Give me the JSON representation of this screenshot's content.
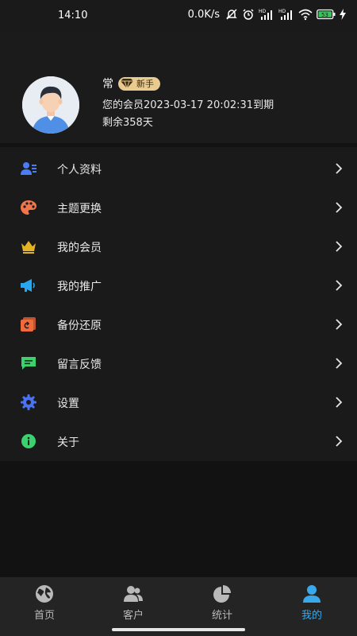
{
  "status_bar": {
    "time": "14:10",
    "network_speed": "0.0K/s",
    "battery": "53",
    "icons": [
      "no-notification-icon",
      "alarm-icon",
      "hd-signal-icon",
      "hd-signal-icon",
      "wifi-icon",
      "battery-icon",
      "charging-icon"
    ]
  },
  "profile": {
    "name": "常",
    "badge": "新手",
    "membership_text": "您的会员2023-03-17 20:02:31到期",
    "remaining_text": "剩余358天"
  },
  "menu": {
    "items": [
      {
        "label": "个人资料",
        "icon": "profile-card-icon",
        "color": "#4a7cf7"
      },
      {
        "label": "主题更换",
        "icon": "palette-icon",
        "color": "#f0754a"
      },
      {
        "label": "我的会员",
        "icon": "crown-icon",
        "color": "#e3b321"
      },
      {
        "label": "我的推广",
        "icon": "megaphone-icon",
        "color": "#27a7f0"
      },
      {
        "label": "备份还原",
        "icon": "backup-icon",
        "color": "#f26a3a"
      },
      {
        "label": "留言反馈",
        "icon": "message-icon",
        "color": "#3bd16f"
      },
      {
        "label": "设置",
        "icon": "gear-icon",
        "color": "#4a72f2"
      },
      {
        "label": "关于",
        "icon": "info-icon",
        "color": "#3bd16f"
      }
    ]
  },
  "tabbar": {
    "tabs": [
      {
        "label": "首页",
        "icon": "globe-icon",
        "active": false
      },
      {
        "label": "客户",
        "icon": "customers-icon",
        "active": false
      },
      {
        "label": "统计",
        "icon": "pie-chart-icon",
        "active": false
      },
      {
        "label": "我的",
        "icon": "person-icon",
        "active": true
      }
    ],
    "active_color": "#3aa9ec",
    "inactive_color": "#b9b9b9"
  }
}
